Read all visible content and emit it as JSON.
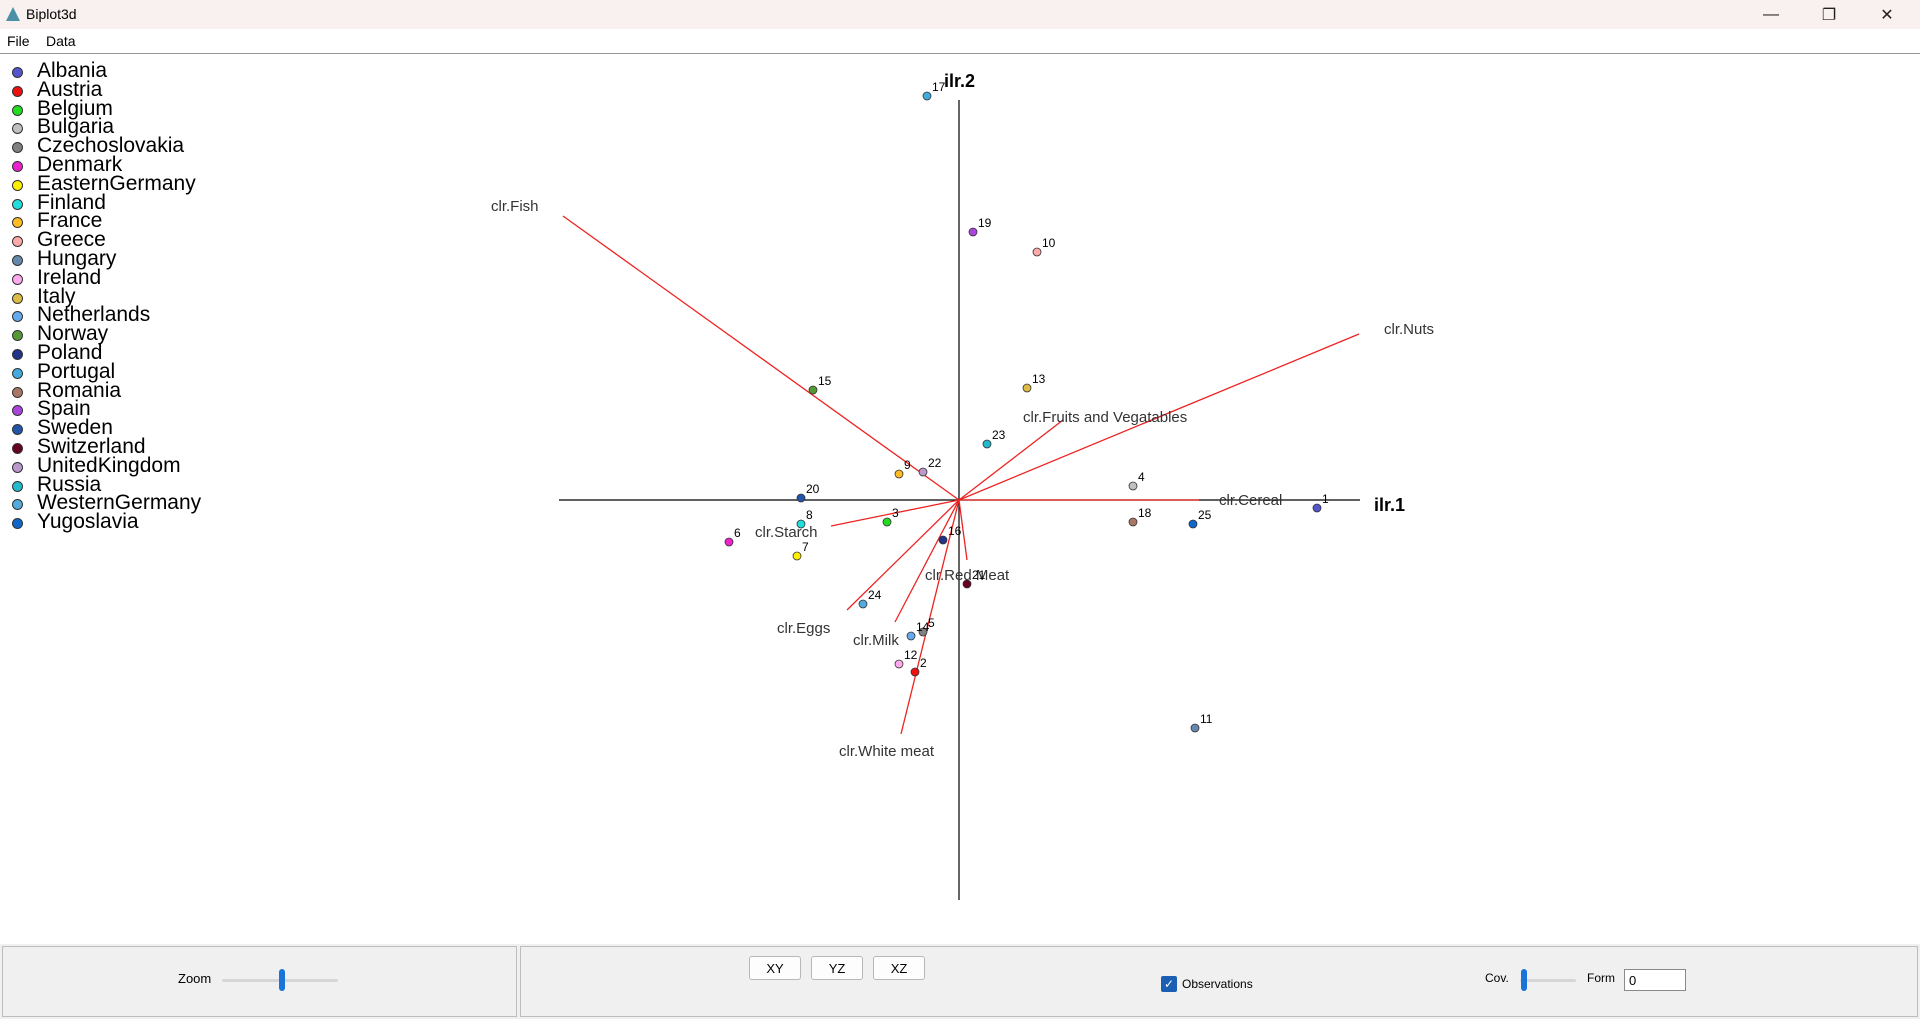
{
  "window": {
    "title": "Biplot3d",
    "controls": [
      "—",
      "❐",
      "✕"
    ]
  },
  "menu": {
    "file": "File",
    "data": "Data"
  },
  "legend": [
    {
      "label": "Albania",
      "color": "#5555cc"
    },
    {
      "label": "Austria",
      "color": "#ee1111"
    },
    {
      "label": "Belgium",
      "color": "#22dd22"
    },
    {
      "label": "Bulgaria",
      "color": "#c0c0c0"
    },
    {
      "label": "Czechoslovakia",
      "color": "#808080"
    },
    {
      "label": "Denmark",
      "color": "#ee22cc"
    },
    {
      "label": "EasternGermany",
      "color": "#ffee00"
    },
    {
      "label": "Finland",
      "color": "#22dddd"
    },
    {
      "label": "France",
      "color": "#ffbb22"
    },
    {
      "label": "Greece",
      "color": "#ffaaaa"
    },
    {
      "label": "Hungary",
      "color": "#6688aa"
    },
    {
      "label": "Ireland",
      "color": "#ffaaee"
    },
    {
      "label": "Italy",
      "color": "#ddbb44"
    },
    {
      "label": "Netherlands",
      "color": "#66aaee"
    },
    {
      "label": "Norway",
      "color": "#559933"
    },
    {
      "label": "Poland",
      "color": "#223388"
    },
    {
      "label": "Portugal",
      "color": "#44aadd"
    },
    {
      "label": "Romania",
      "color": "#aa7766"
    },
    {
      "label": "Spain",
      "color": "#aa44dd"
    },
    {
      "label": "Sweden",
      "color": "#2255aa"
    },
    {
      "label": "Switzerland",
      "color": "#660022"
    },
    {
      "label": "UnitedKingdom",
      "color": "#bb99cc"
    },
    {
      "label": "Russia",
      "color": "#22bbcc"
    },
    {
      "label": "WesternGermany",
      "color": "#55aadd"
    },
    {
      "label": "Yugoslavia",
      "color": "#1166cc"
    }
  ],
  "chart_data": {
    "type": "scatter",
    "axes": {
      "x_label": "ilr.1",
      "y_label": "ilr.2"
    },
    "points": [
      {
        "id": "1",
        "x": 1.79,
        "y": -0.04,
        "color": "#5555cc"
      },
      {
        "id": "2",
        "x": -0.22,
        "y": -0.86,
        "color": "#ee1111"
      },
      {
        "id": "3",
        "x": -0.36,
        "y": -0.11,
        "color": "#22dd22"
      },
      {
        "id": "4",
        "x": 0.87,
        "y": 0.07,
        "color": "#c0c0c0"
      },
      {
        "id": "5",
        "x": -0.18,
        "y": -0.66,
        "color": "#808080"
      },
      {
        "id": "6",
        "x": -1.15,
        "y": -0.21,
        "color": "#ee22cc"
      },
      {
        "id": "7",
        "x": -0.81,
        "y": -0.28,
        "color": "#ffee00"
      },
      {
        "id": "8",
        "x": -0.79,
        "y": -0.12,
        "color": "#22dddd"
      },
      {
        "id": "9",
        "x": -0.3,
        "y": 0.13,
        "color": "#ffbb22"
      },
      {
        "id": "10",
        "x": 0.39,
        "y": 1.24,
        "color": "#ffaaaa"
      },
      {
        "id": "11",
        "x": 1.18,
        "y": -1.14,
        "color": "#6688aa"
      },
      {
        "id": "12",
        "x": -0.3,
        "y": -0.82,
        "color": "#ffaaee"
      },
      {
        "id": "13",
        "x": 0.34,
        "y": 0.56,
        "color": "#ddbb44"
      },
      {
        "id": "14",
        "x": -0.24,
        "y": -0.68,
        "color": "#66aaee"
      },
      {
        "id": "15",
        "x": -0.73,
        "y": 0.55,
        "color": "#559933"
      },
      {
        "id": "16",
        "x": -0.08,
        "y": -0.2,
        "color": "#223388"
      },
      {
        "id": "17",
        "x": -0.16,
        "y": 2.02,
        "color": "#44aadd"
      },
      {
        "id": "18",
        "x": 0.87,
        "y": -0.11,
        "color": "#aa7766"
      },
      {
        "id": "19",
        "x": 0.07,
        "y": 1.34,
        "color": "#aa44dd"
      },
      {
        "id": "20",
        "x": -0.79,
        "y": 0.01,
        "color": "#2255aa"
      },
      {
        "id": "21",
        "x": 0.04,
        "y": -0.42,
        "color": "#660022"
      },
      {
        "id": "22",
        "x": -0.18,
        "y": 0.14,
        "color": "#bb99cc"
      },
      {
        "id": "23",
        "x": 0.14,
        "y": 0.28,
        "color": "#22bbcc"
      },
      {
        "id": "24",
        "x": -0.48,
        "y": -0.52,
        "color": "#55aadd"
      },
      {
        "id": "25",
        "x": 1.17,
        "y": -0.12,
        "color": "#1166cc"
      }
    ],
    "vectors": [
      {
        "label": "clr.Fish",
        "x": -1.98,
        "y": 1.42
      },
      {
        "label": "clr.Nuts",
        "x": 2.0,
        "y": 0.83
      },
      {
        "label": "clr.Fruits and Vegatables",
        "x": 0.52,
        "y": 0.4
      },
      {
        "label": "clr.Cereal",
        "x": 1.2,
        "y": 0.0
      },
      {
        "label": "clr.Starch",
        "x": -0.64,
        "y": -0.13
      },
      {
        "label": "clr.Red Meat",
        "x": 0.04,
        "y": -0.3
      },
      {
        "label": "clr.Eggs",
        "x": -0.56,
        "y": -0.55
      },
      {
        "label": "clr.Milk",
        "x": -0.32,
        "y": -0.61
      },
      {
        "label": "clr.White meat",
        "x": -0.29,
        "y": -1.17
      }
    ]
  },
  "controls": {
    "zoom_label": "Zoom",
    "zoom_level": 0.52,
    "view_buttons": [
      "XY",
      "YZ",
      "XZ"
    ],
    "observations_label": "Observations",
    "observations_checked": true,
    "cov_label": "Cov.",
    "cov_level": 0.02,
    "form_label": "Form",
    "form_value": "0"
  }
}
